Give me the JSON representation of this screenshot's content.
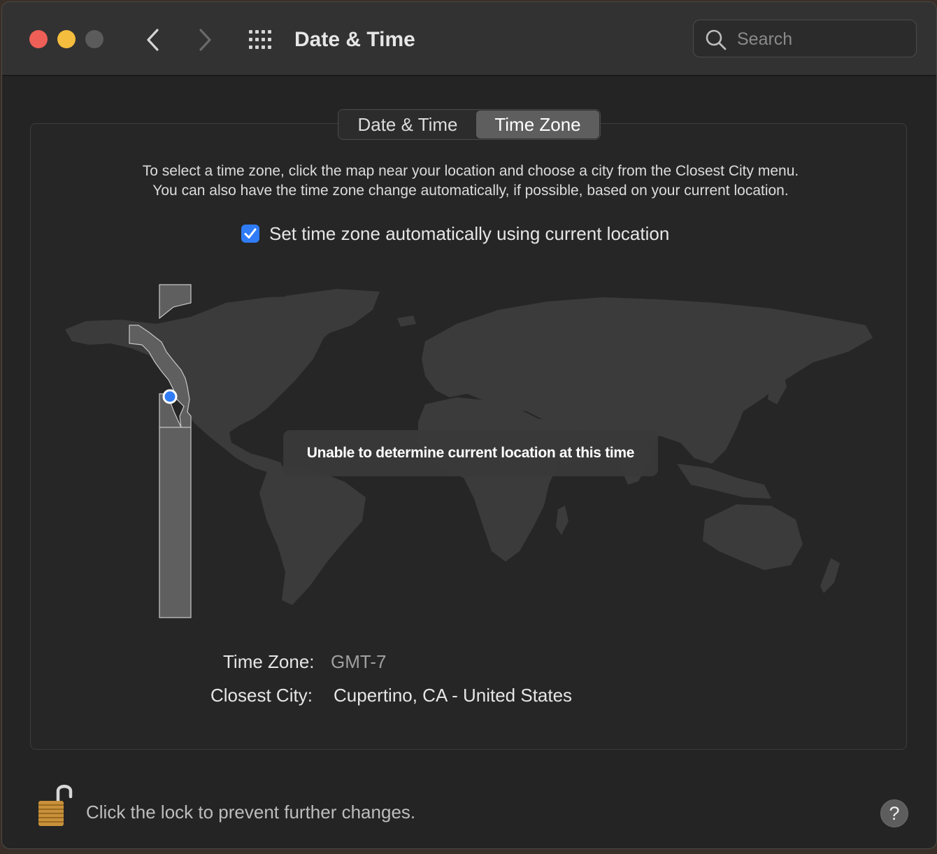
{
  "window": {
    "title": "Date & Time"
  },
  "search": {
    "placeholder": "Search"
  },
  "tabs": [
    {
      "label": "Date & Time",
      "selected": false
    },
    {
      "label": "Time Zone",
      "selected": true
    }
  ],
  "instructions": {
    "line1": "To select a time zone, click the map near your location and choose a city from the Closest City menu.",
    "line2": "You can also have the time zone change automatically, if possible, based on your current location."
  },
  "auto_timezone": {
    "label": "Set time zone automatically using current location",
    "checked": true
  },
  "map": {
    "message": "Unable to determine current location at this time"
  },
  "info": {
    "time_zone_label": "Time Zone:",
    "time_zone_value": "GMT-7",
    "closest_city_label": "Closest City:",
    "closest_city_value": "Cupertino, CA - United States"
  },
  "footer": {
    "lock_text": "Click the lock to prevent further changes.",
    "help_label": "?"
  },
  "colors": {
    "close": "#ee5f57",
    "minimize": "#f5bd3e",
    "accent": "#2f7cf6"
  }
}
